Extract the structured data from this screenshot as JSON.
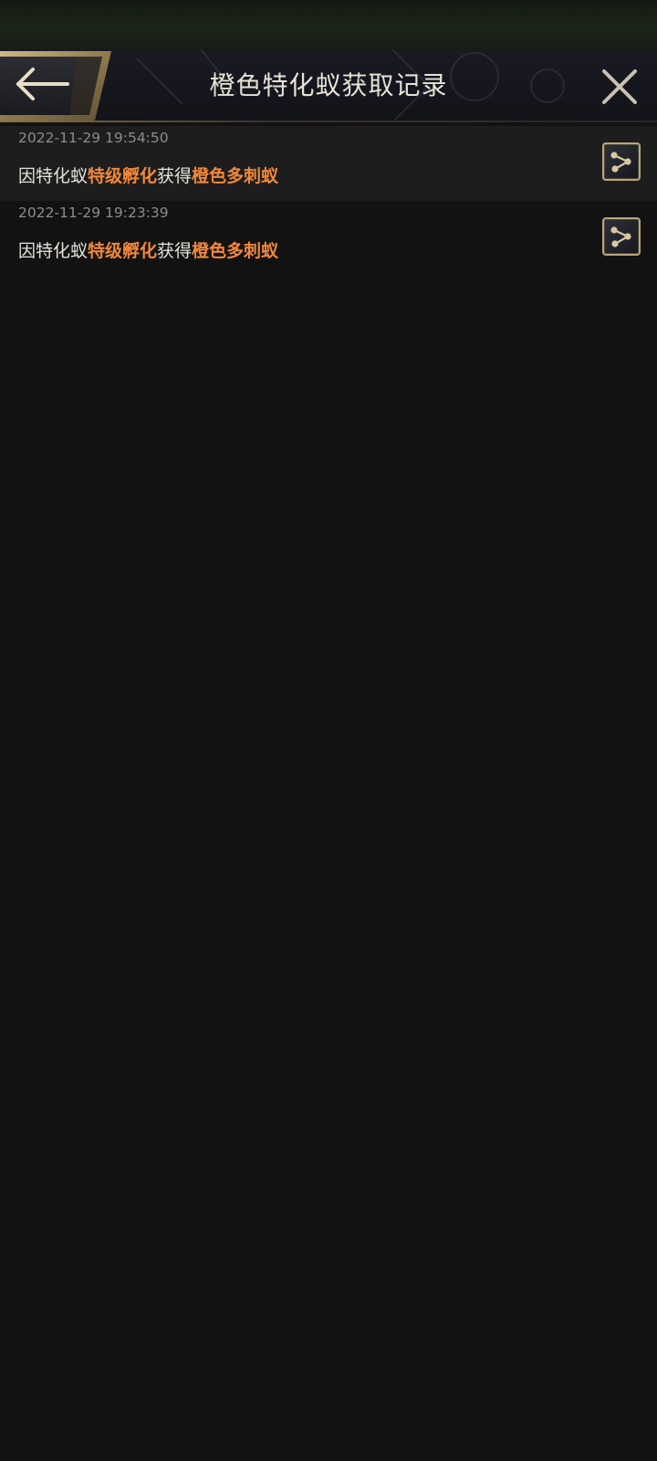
{
  "header": {
    "title": "橙色特化蚁获取记录",
    "back_icon": "arrow-left-icon",
    "close_icon": "close-icon"
  },
  "records": [
    {
      "time": "2022-11-29 19:54:50",
      "prefix": "因特化蚁",
      "method": "特级孵化",
      "verb": "获得",
      "item": "橙色多刺蚁",
      "share_icon": "share-icon"
    },
    {
      "time": "2022-11-29 19:23:39",
      "prefix": "因特化蚁",
      "method": "特级孵化",
      "verb": "获得",
      "item": "橙色多刺蚁",
      "share_icon": "share-icon"
    }
  ],
  "colors": {
    "background": "#121212",
    "highlight": "#f0883c",
    "gold": "#b8a57c",
    "title_text": "#e8e2d6"
  }
}
